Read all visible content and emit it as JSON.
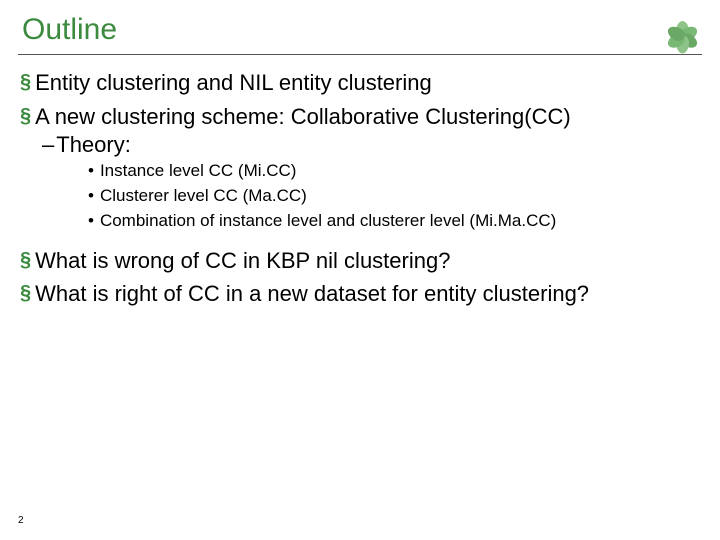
{
  "title": "Outline",
  "bullets": {
    "b1_0": "Entity clustering and NIL entity clustering",
    "b1_1": "A new clustering scheme: Collaborative Clustering(CC)",
    "b2_0": "Theory:",
    "b3_0": "Instance level  CC (Mi.CC)",
    "b3_1": "Clusterer level CC (Ma.CC)",
    "b3_2": "Combination of instance level and clusterer level (Mi.Ma.CC)",
    "b1_2": "What is wrong of CC in KBP nil clustering?",
    "b1_3": "What is right of CC in a new dataset for entity clustering?"
  },
  "page_number": "2"
}
